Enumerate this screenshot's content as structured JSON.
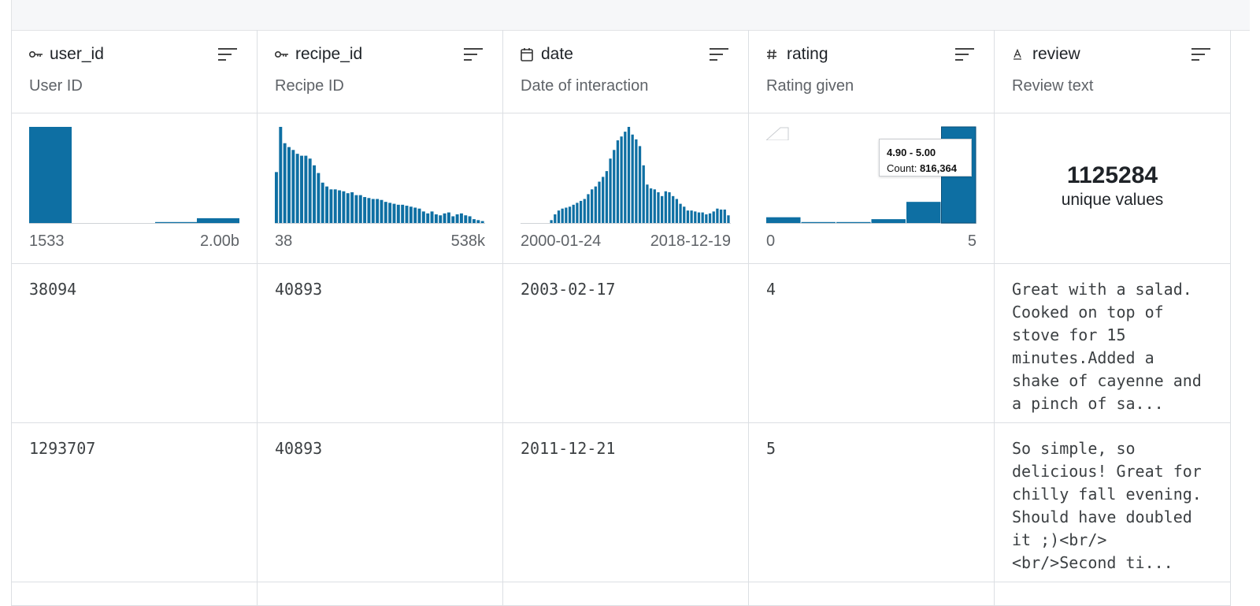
{
  "columns": [
    {
      "name": "user_id",
      "icon": "key-icon",
      "description": "User ID",
      "axis_min": "1533",
      "axis_max": "2.00b"
    },
    {
      "name": "recipe_id",
      "icon": "key-icon",
      "description": "Recipe ID",
      "axis_min": "38",
      "axis_max": "538k"
    },
    {
      "name": "date",
      "icon": "calendar-icon",
      "description": "Date of interaction",
      "axis_min": "2000-01-24",
      "axis_max": "2018-12-19"
    },
    {
      "name": "rating",
      "icon": "hash-icon",
      "description": "Rating given",
      "axis_min": "0",
      "axis_max": "5"
    },
    {
      "name": "review",
      "icon": "text-icon",
      "description": "Review text",
      "unique_count": "1125284",
      "unique_label": "unique values"
    }
  ],
  "tooltip": {
    "range": "4.90 - 5.00",
    "count_label": "Count:",
    "count_value": "816,364"
  },
  "rows": [
    [
      "38094",
      "40893",
      "2003-02-17",
      "4",
      "Great with a salad.\nCooked on top of\nstove for 15\nminutes.Added a\nshake of cayenne and\na pinch of sa..."
    ],
    [
      "1293707",
      "40893",
      "2011-12-21",
      "5",
      "So simple, so\ndelicious! Great for\nchilly fall evening.\nShould have doubled\nit ;)<br/>\n<br/>Second ti..."
    ]
  ],
  "colors": {
    "bar": "#0e6fa3",
    "border": "#dcdfe3",
    "header_bg": "#f6f7f9"
  },
  "chart_data": [
    {
      "type": "bar",
      "column": "user_id",
      "values": [
        100,
        0,
        0,
        0,
        1,
        5
      ],
      "xlim": [
        "1533",
        "2.00b"
      ]
    },
    {
      "type": "bar",
      "column": "recipe_id",
      "values": [
        53,
        100,
        83,
        79,
        76,
        72,
        70,
        70,
        67,
        60,
        52,
        42,
        38,
        35,
        35,
        34,
        33,
        31,
        32,
        29,
        29,
        27,
        26,
        25,
        25,
        24,
        22,
        21,
        20,
        19,
        19,
        18,
        17,
        16,
        15,
        12,
        10,
        12,
        9,
        8,
        10,
        11,
        7,
        9,
        10,
        8,
        7,
        4,
        3,
        2
      ],
      "xlim": [
        "38",
        "538k"
      ]
    },
    {
      "type": "bar",
      "column": "date",
      "values": [
        0,
        0,
        0,
        0,
        0,
        0,
        0,
        0,
        3,
        9,
        13,
        15,
        16,
        17,
        19,
        21,
        23,
        25,
        30,
        35,
        38,
        43,
        48,
        54,
        67,
        76,
        86,
        90,
        95,
        100,
        92,
        87,
        80,
        60,
        40,
        36,
        35,
        32,
        28,
        33,
        32,
        28,
        25,
        20,
        17,
        13,
        13,
        12,
        11,
        11,
        9,
        10,
        12,
        15,
        14,
        14,
        8
      ],
      "xlim": [
        "2000-01-24",
        "2018-12-19"
      ]
    },
    {
      "type": "bar",
      "column": "rating",
      "categories": [
        "0",
        "1",
        "2",
        "3",
        "4",
        "5"
      ],
      "values": [
        6,
        1,
        1,
        4,
        22,
        100
      ],
      "xlim": [
        "0",
        "5"
      ]
    }
  ]
}
